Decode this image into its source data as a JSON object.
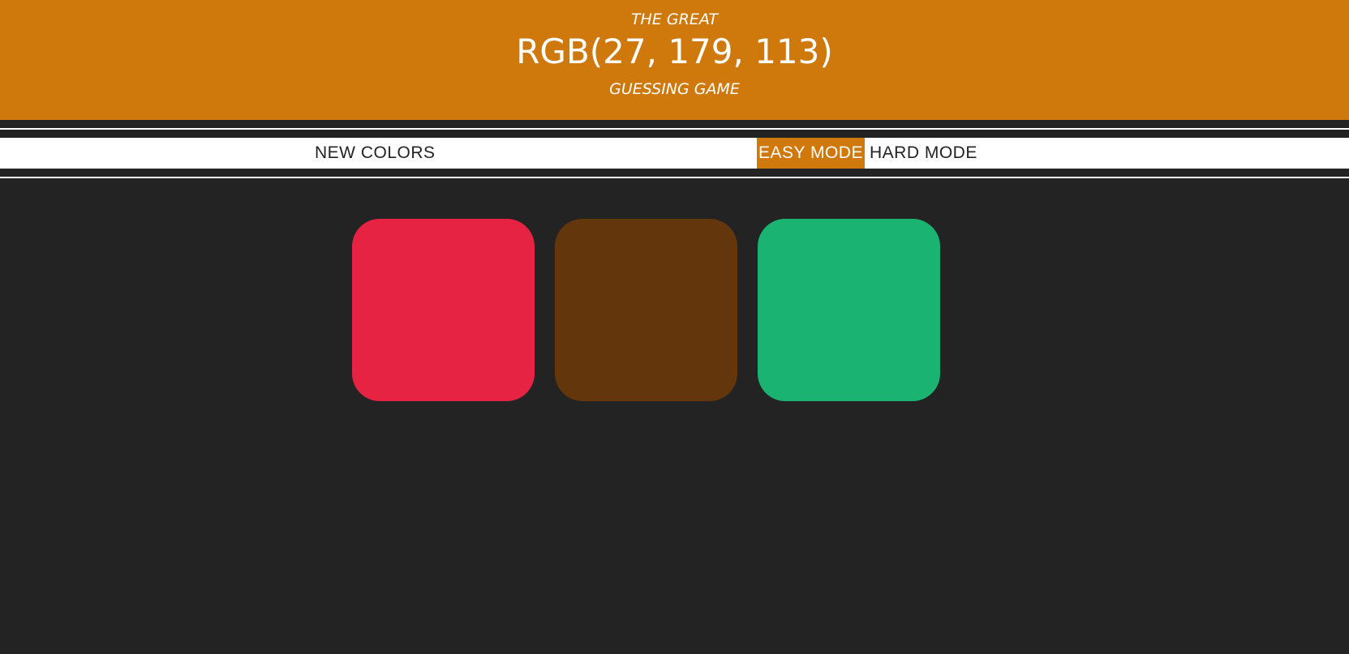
{
  "header": {
    "line1": "THE GREAT",
    "line2": "RGB(27, 179, 113)",
    "line3": "GUESSING GAME",
    "background": "#cf780c",
    "text_color": "#ffffff"
  },
  "controls": {
    "new_colors": "NEW COLORS",
    "easy_mode": "EASY MODE",
    "hard_mode": "HARD MODE",
    "selected": "easy_mode",
    "selected_color": "#cf780c"
  },
  "squares": [
    {
      "color": "#e62343"
    },
    {
      "color": "#63360c"
    },
    {
      "color": "#1bb371"
    }
  ],
  "background": "#232323"
}
